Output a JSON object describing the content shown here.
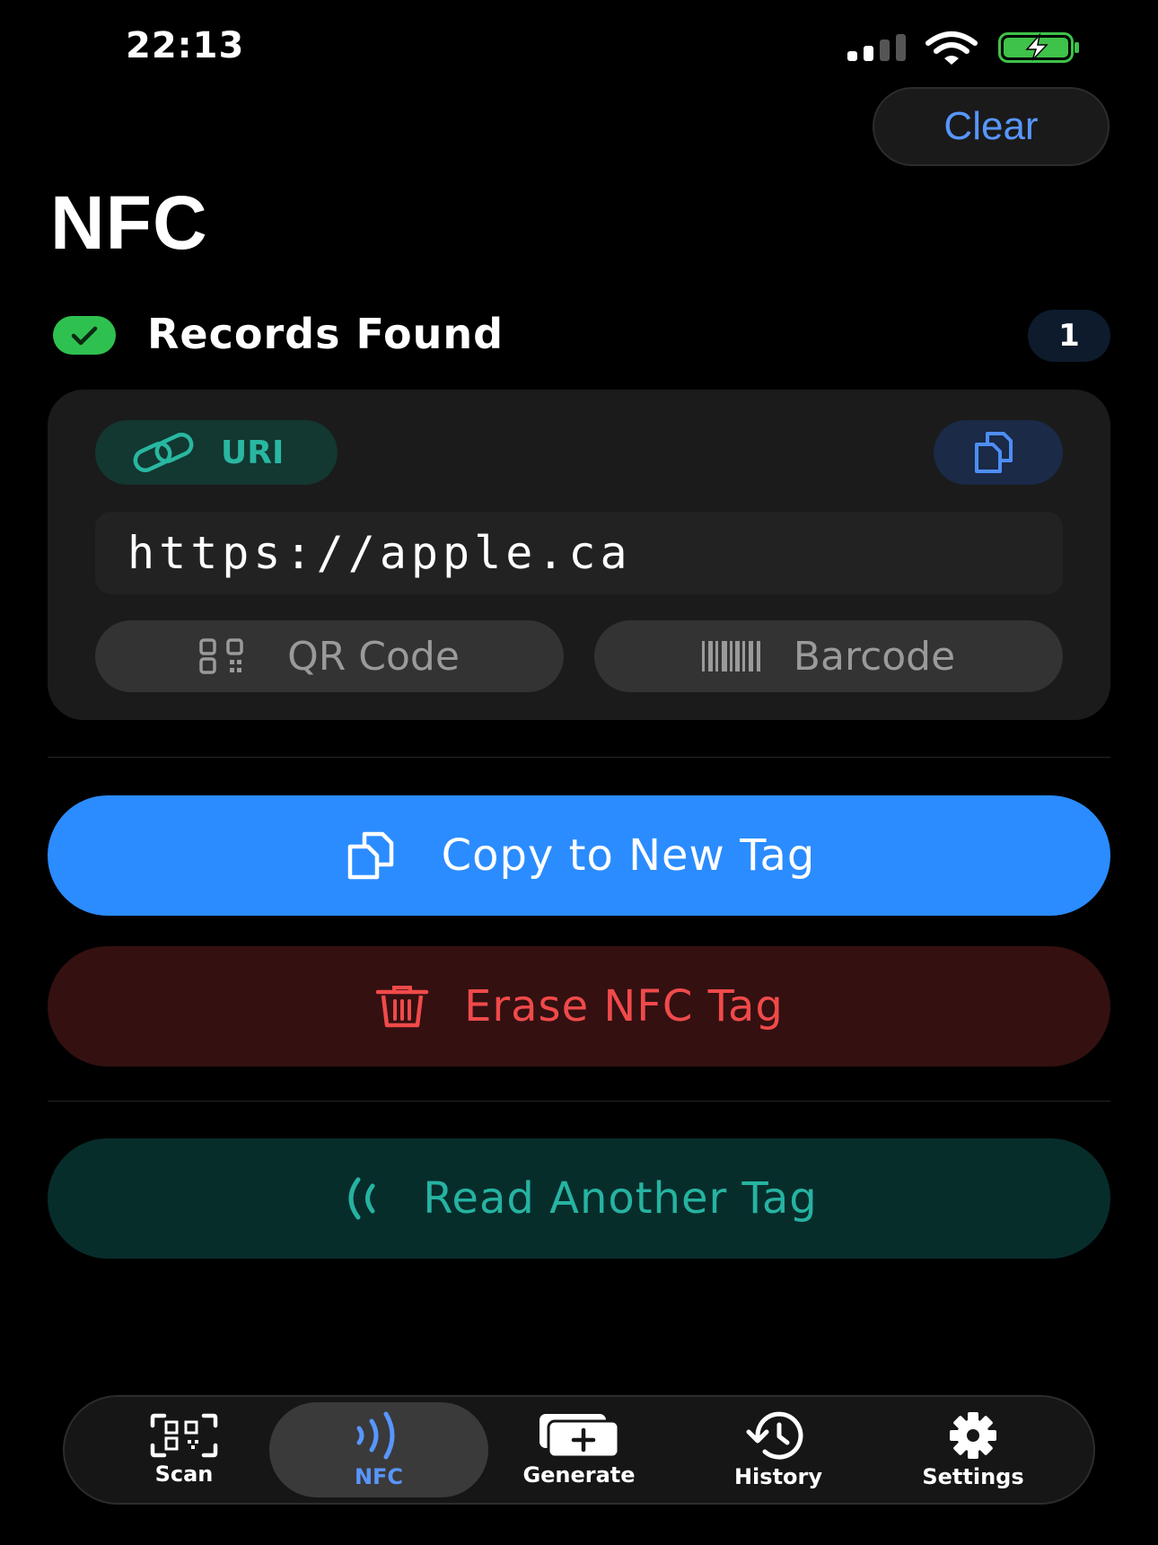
{
  "status_bar": {
    "time": "22:13"
  },
  "header": {
    "clear_label": "Clear",
    "title": "NFC"
  },
  "records": {
    "heading": "Records Found",
    "count": "1",
    "items": [
      {
        "type_label": "URI",
        "value": "https://apple.ca",
        "qr_label": "QR Code",
        "barcode_label": "Barcode"
      }
    ]
  },
  "actions": {
    "copy_label": "Copy to New Tag",
    "erase_label": "Erase NFC Tag",
    "read_label": "Read Another Tag"
  },
  "tabbar": {
    "active": "NFC",
    "items": [
      {
        "label": "Scan",
        "icon": "qr-scan-icon"
      },
      {
        "label": "NFC",
        "icon": "nfc-icon"
      },
      {
        "label": "Generate",
        "icon": "generate-icon"
      },
      {
        "label": "History",
        "icon": "history-icon"
      },
      {
        "label": "Settings",
        "icon": "gear-icon"
      }
    ]
  },
  "colors": {
    "accent_blue": "#2b8cff",
    "clear_text": "#5896ff",
    "success_green": "#2fc14f",
    "teal": "#26b3a1",
    "danger_red": "#f04a4a"
  }
}
